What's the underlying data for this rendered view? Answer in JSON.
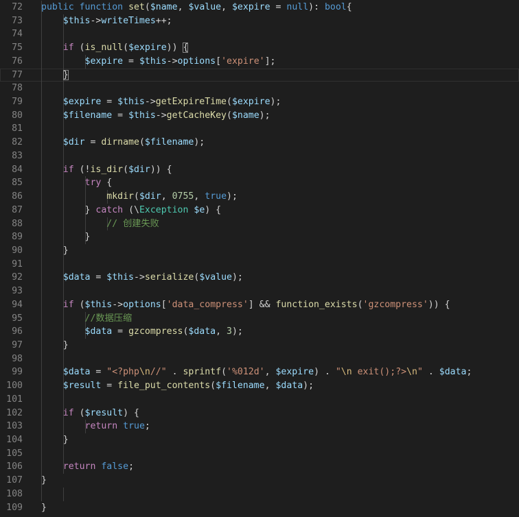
{
  "editor": {
    "theme": {
      "background": "#1e1e1e",
      "line_number": "#858585",
      "keyword": "#569cd6",
      "control": "#c586c0",
      "variable": "#9cdcfe",
      "function": "#dcdcaa",
      "string": "#ce9178",
      "number": "#b5cea8",
      "comment": "#6a9955",
      "class": "#4ec9b0"
    },
    "lines": [
      {
        "n": "72",
        "indent": 1,
        "tokens": [
          [
            "kw",
            "public"
          ],
          [
            "op",
            " "
          ],
          [
            "kw",
            "function"
          ],
          [
            "op",
            " "
          ],
          [
            "fn",
            "set"
          ],
          [
            "op",
            "("
          ],
          [
            "var",
            "$name"
          ],
          [
            "op",
            ", "
          ],
          [
            "var",
            "$value"
          ],
          [
            "op",
            ", "
          ],
          [
            "var",
            "$expire"
          ],
          [
            "op",
            " = "
          ],
          [
            "kw",
            "null"
          ],
          [
            "op",
            "): "
          ],
          [
            "kw",
            "bool"
          ],
          [
            "op",
            "{"
          ]
        ]
      },
      {
        "n": "73",
        "indent": 2,
        "tokens": [
          [
            "var",
            "$this"
          ],
          [
            "op",
            "->"
          ],
          [
            "var",
            "writeTimes"
          ],
          [
            "op",
            "++;"
          ]
        ]
      },
      {
        "n": "74",
        "indent": 0,
        "tokens": []
      },
      {
        "n": "75",
        "indent": 2,
        "tokens": [
          [
            "ctl",
            "if"
          ],
          [
            "op",
            " ("
          ],
          [
            "fn",
            "is_null"
          ],
          [
            "op",
            "("
          ],
          [
            "var",
            "$expire"
          ],
          [
            "op",
            ")) "
          ],
          [
            "box",
            "{"
          ]
        ]
      },
      {
        "n": "76",
        "indent": 3,
        "tokens": [
          [
            "var",
            "$expire"
          ],
          [
            "op",
            " = "
          ],
          [
            "var",
            "$this"
          ],
          [
            "op",
            "->"
          ],
          [
            "var",
            "options"
          ],
          [
            "op",
            "["
          ],
          [
            "str",
            "'expire'"
          ],
          [
            "op",
            "];"
          ]
        ]
      },
      {
        "n": "77",
        "indent": 2,
        "active": true,
        "tokens": [
          [
            "box",
            "}"
          ]
        ]
      },
      {
        "n": "78",
        "indent": 0,
        "tokens": []
      },
      {
        "n": "79",
        "indent": 2,
        "tokens": [
          [
            "var",
            "$expire"
          ],
          [
            "op",
            " = "
          ],
          [
            "var",
            "$this"
          ],
          [
            "op",
            "->"
          ],
          [
            "fn",
            "getExpireTime"
          ],
          [
            "op",
            "("
          ],
          [
            "var",
            "$expire"
          ],
          [
            "op",
            ");"
          ]
        ]
      },
      {
        "n": "80",
        "indent": 2,
        "tokens": [
          [
            "var",
            "$filename"
          ],
          [
            "op",
            " = "
          ],
          [
            "var",
            "$this"
          ],
          [
            "op",
            "->"
          ],
          [
            "fn",
            "getCacheKey"
          ],
          [
            "op",
            "("
          ],
          [
            "var",
            "$name"
          ],
          [
            "op",
            ");"
          ]
        ]
      },
      {
        "n": "81",
        "indent": 0,
        "tokens": []
      },
      {
        "n": "82",
        "indent": 2,
        "tokens": [
          [
            "var",
            "$dir"
          ],
          [
            "op",
            " = "
          ],
          [
            "fn",
            "dirname"
          ],
          [
            "op",
            "("
          ],
          [
            "var",
            "$filename"
          ],
          [
            "op",
            ");"
          ]
        ]
      },
      {
        "n": "83",
        "indent": 0,
        "tokens": []
      },
      {
        "n": "84",
        "indent": 2,
        "tokens": [
          [
            "ctl",
            "if"
          ],
          [
            "op",
            " (!"
          ],
          [
            "fn",
            "is_dir"
          ],
          [
            "op",
            "("
          ],
          [
            "var",
            "$dir"
          ],
          [
            "op",
            ")) {"
          ]
        ]
      },
      {
        "n": "85",
        "indent": 3,
        "tokens": [
          [
            "ctl",
            "try"
          ],
          [
            "op",
            " {"
          ]
        ]
      },
      {
        "n": "86",
        "indent": 4,
        "tokens": [
          [
            "fn",
            "mkdir"
          ],
          [
            "op",
            "("
          ],
          [
            "var",
            "$dir"
          ],
          [
            "op",
            ", "
          ],
          [
            "num",
            "0755"
          ],
          [
            "op",
            ", "
          ],
          [
            "kw",
            "true"
          ],
          [
            "op",
            ");"
          ]
        ]
      },
      {
        "n": "87",
        "indent": 3,
        "tokens": [
          [
            "op",
            "} "
          ],
          [
            "ctl",
            "catch"
          ],
          [
            "op",
            " (\\"
          ],
          [
            "cls",
            "Exception"
          ],
          [
            "op",
            " "
          ],
          [
            "var",
            "$e"
          ],
          [
            "op",
            ") {"
          ]
        ]
      },
      {
        "n": "88",
        "indent": 4,
        "tokens": [
          [
            "com",
            "// 创建失败"
          ]
        ]
      },
      {
        "n": "89",
        "indent": 3,
        "tokens": [
          [
            "op",
            "}"
          ]
        ]
      },
      {
        "n": "90",
        "indent": 2,
        "tokens": [
          [
            "op",
            "}"
          ]
        ]
      },
      {
        "n": "91",
        "indent": 0,
        "tokens": []
      },
      {
        "n": "92",
        "indent": 2,
        "tokens": [
          [
            "var",
            "$data"
          ],
          [
            "op",
            " = "
          ],
          [
            "var",
            "$this"
          ],
          [
            "op",
            "->"
          ],
          [
            "fn",
            "serialize"
          ],
          [
            "op",
            "("
          ],
          [
            "var",
            "$value"
          ],
          [
            "op",
            ");"
          ]
        ]
      },
      {
        "n": "93",
        "indent": 0,
        "tokens": []
      },
      {
        "n": "94",
        "indent": 2,
        "tokens": [
          [
            "ctl",
            "if"
          ],
          [
            "op",
            " ("
          ],
          [
            "var",
            "$this"
          ],
          [
            "op",
            "->"
          ],
          [
            "var",
            "options"
          ],
          [
            "op",
            "["
          ],
          [
            "str",
            "'data_compress'"
          ],
          [
            "op",
            "] && "
          ],
          [
            "fn",
            "function_exists"
          ],
          [
            "op",
            "("
          ],
          [
            "str",
            "'gzcompress'"
          ],
          [
            "op",
            ")) {"
          ]
        ]
      },
      {
        "n": "95",
        "indent": 3,
        "tokens": [
          [
            "com",
            "//数据压缩"
          ]
        ]
      },
      {
        "n": "96",
        "indent": 3,
        "tokens": [
          [
            "var",
            "$data"
          ],
          [
            "op",
            " = "
          ],
          [
            "fn",
            "gzcompress"
          ],
          [
            "op",
            "("
          ],
          [
            "var",
            "$data"
          ],
          [
            "op",
            ", "
          ],
          [
            "num",
            "3"
          ],
          [
            "op",
            ");"
          ]
        ]
      },
      {
        "n": "97",
        "indent": 2,
        "tokens": [
          [
            "op",
            "}"
          ]
        ]
      },
      {
        "n": "98",
        "indent": 0,
        "tokens": []
      },
      {
        "n": "99",
        "indent": 2,
        "tokens": [
          [
            "var",
            "$data"
          ],
          [
            "op",
            " = "
          ],
          [
            "str",
            "\"<?php"
          ],
          [
            "esc",
            "\\n"
          ],
          [
            "str",
            "//\""
          ],
          [
            "op",
            " . "
          ],
          [
            "fn",
            "sprintf"
          ],
          [
            "op",
            "("
          ],
          [
            "str",
            "'%012d'"
          ],
          [
            "op",
            ", "
          ],
          [
            "var",
            "$expire"
          ],
          [
            "op",
            ") . "
          ],
          [
            "str",
            "\""
          ],
          [
            "esc",
            "\\n"
          ],
          [
            "str",
            " exit();?>"
          ],
          [
            "esc",
            "\\n"
          ],
          [
            "str",
            "\""
          ],
          [
            "op",
            " . "
          ],
          [
            "var",
            "$data"
          ],
          [
            "op",
            ";"
          ]
        ]
      },
      {
        "n": "100",
        "indent": 2,
        "tokens": [
          [
            "var",
            "$result"
          ],
          [
            "op",
            " = "
          ],
          [
            "fn",
            "file_put_contents"
          ],
          [
            "op",
            "("
          ],
          [
            "var",
            "$filename"
          ],
          [
            "op",
            ", "
          ],
          [
            "var",
            "$data"
          ],
          [
            "op",
            ");"
          ]
        ]
      },
      {
        "n": "101",
        "indent": 0,
        "tokens": []
      },
      {
        "n": "102",
        "indent": 2,
        "tokens": [
          [
            "ctl",
            "if"
          ],
          [
            "op",
            " ("
          ],
          [
            "var",
            "$result"
          ],
          [
            "op",
            ") {"
          ]
        ]
      },
      {
        "n": "103",
        "indent": 3,
        "tokens": [
          [
            "ctl",
            "return"
          ],
          [
            "op",
            " "
          ],
          [
            "kw",
            "true"
          ],
          [
            "op",
            ";"
          ]
        ]
      },
      {
        "n": "104",
        "indent": 2,
        "tokens": [
          [
            "op",
            "}"
          ]
        ]
      },
      {
        "n": "105",
        "indent": 0,
        "tokens": []
      },
      {
        "n": "106",
        "indent": 2,
        "tokens": [
          [
            "ctl",
            "return"
          ],
          [
            "op",
            " "
          ],
          [
            "kw",
            "false"
          ],
          [
            "op",
            ";"
          ]
        ]
      },
      {
        "n": "107",
        "indent": 1,
        "tokens": [
          [
            "op",
            "}"
          ]
        ]
      },
      {
        "n": "108",
        "indent": 0,
        "tokens": []
      },
      {
        "n": "109",
        "indent": 0,
        "tokens": [
          [
            "op",
            "}"
          ]
        ]
      }
    ]
  }
}
